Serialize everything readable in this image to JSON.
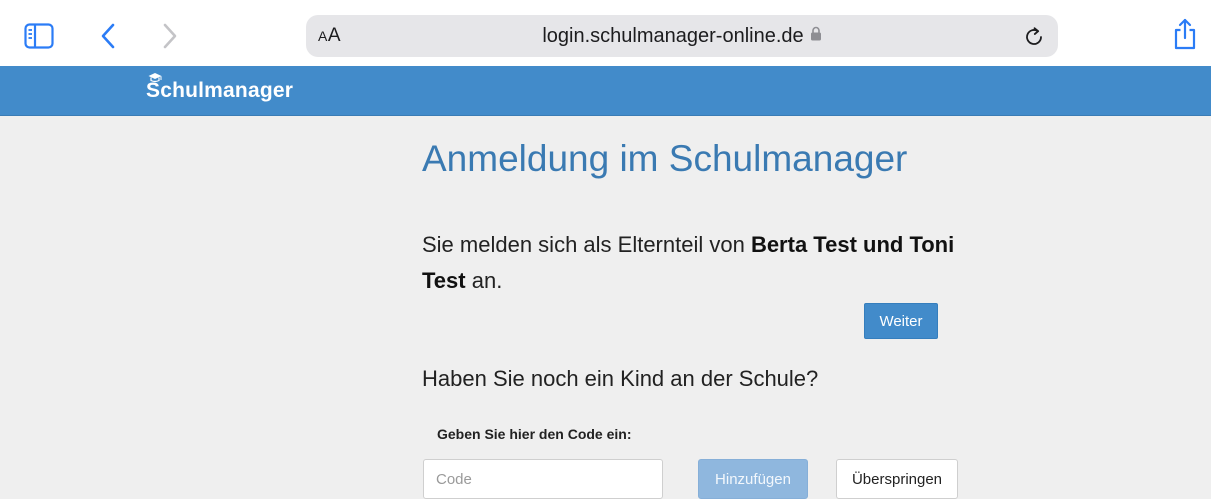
{
  "browser": {
    "aa_label_small": "A",
    "aa_label_large": "A",
    "url": "login.schulmanager-online.de",
    "icons": {
      "sidebar": "sidebar-icon",
      "back": "chevron-left-icon",
      "forward": "chevron-right-icon",
      "lock": "lock-icon",
      "reload": "reload-icon",
      "share": "share-icon"
    }
  },
  "app": {
    "brand": "Schulmanager",
    "brand_icon": "graduation-cap-icon",
    "header_color": "#428bca"
  },
  "main": {
    "title": "Anmeldung im Schulmanager",
    "info_prefix": "Sie melden sich als Elternteil von ",
    "info_names": "Berta Test und Toni Test",
    "info_suffix": " an.",
    "continue_button": "Weiter",
    "question": "Haben Sie noch ein Kind an der Schule?",
    "code_label": "Geben Sie hier den Code ein:",
    "code_placeholder": "Code",
    "code_value": "",
    "add_button": "Hinzufügen",
    "skip_button": "Überspringen"
  }
}
